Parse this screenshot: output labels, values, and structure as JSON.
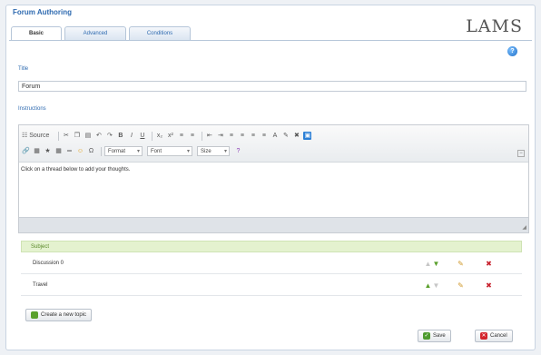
{
  "app": {
    "title": "Forum Authoring",
    "logo": "LAMS"
  },
  "tabs": [
    {
      "label": "Basic",
      "active": true
    },
    {
      "label": "Advanced",
      "active": false
    },
    {
      "label": "Conditions",
      "active": false
    }
  ],
  "form": {
    "title_label": "Title",
    "title_value": "Forum",
    "instructions_label": "Instructions"
  },
  "editor": {
    "source_label": "Source",
    "format_select": "Format",
    "font_select": "Font",
    "size_select": "Size",
    "content": "Click on a thread below to add your thoughts."
  },
  "topics": {
    "header": "Subject",
    "rows": [
      {
        "name": "Discussion 0"
      },
      {
        "name": "Travel"
      }
    ],
    "create_label": "Create a new topic"
  },
  "actions": {
    "save_label": "Save",
    "cancel_label": "Cancel"
  },
  "colors": {
    "accent": "#2e6ab0",
    "topic_header_bg": "#e4f2cf",
    "delete": "#c8232f"
  }
}
